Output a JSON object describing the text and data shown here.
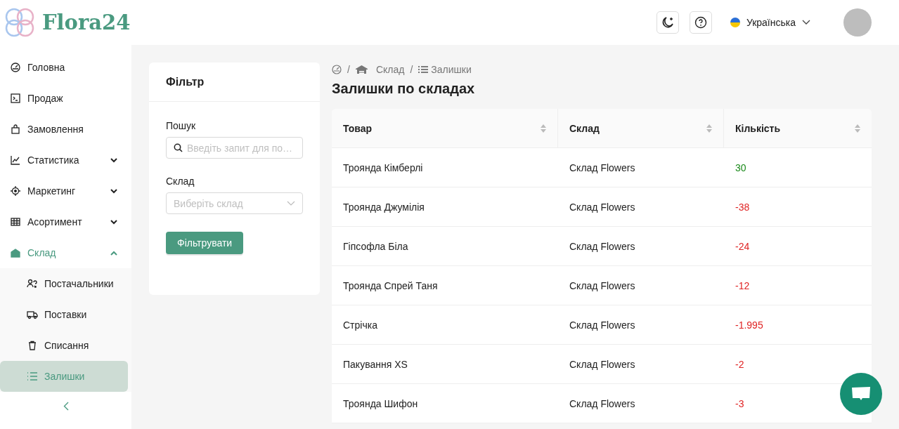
{
  "brand": "Flora24",
  "header": {
    "language": "Українська"
  },
  "sidebar": {
    "items": [
      {
        "label": "Головна",
        "kind": "link",
        "selected": false
      },
      {
        "label": "Продаж",
        "kind": "link",
        "selected": false
      },
      {
        "label": "Замовлення",
        "kind": "link",
        "selected": false
      },
      {
        "label": "Статистика",
        "kind": "group",
        "expanded": false,
        "selected": false
      },
      {
        "label": "Маркетинг",
        "kind": "group",
        "expanded": false,
        "selected": false
      },
      {
        "label": "Асортимент",
        "kind": "group",
        "expanded": false,
        "selected": false
      },
      {
        "label": "Склад",
        "kind": "group",
        "expanded": true,
        "selected": true,
        "children": [
          {
            "label": "Постачальники",
            "selected": false
          },
          {
            "label": "Поставки",
            "selected": false
          },
          {
            "label": "Списання",
            "selected": false
          },
          {
            "label": "Залишки",
            "selected": true
          }
        ]
      }
    ]
  },
  "filter": {
    "title": "Фільтр",
    "search_label": "Пошук",
    "search": {
      "placeholder": "Введіть запит для по…"
    },
    "warehouse_label": "Склад",
    "warehouse": {
      "placeholder": "Виберіть склад"
    },
    "button": "Фільтрувати"
  },
  "breadcrumbs": [
    "Склад",
    "Залишки"
  ],
  "breadcrumb_separator": "/",
  "title": "Залишки по складах",
  "table": {
    "columns": [
      "Товар",
      "Склад",
      "Кількість"
    ],
    "rows": [
      {
        "product": "Троянда Кімберлі",
        "warehouse": "Склад Flowers",
        "quantity": "30",
        "color": "#1a8a1a"
      },
      {
        "product": "Троянда Джумілія",
        "warehouse": "Склад Flowers",
        "quantity": "-38",
        "color": "#e02424"
      },
      {
        "product": "Гіпсофла Біла",
        "warehouse": "Склад Flowers",
        "quantity": "-24",
        "color": "#e02424"
      },
      {
        "product": "Троянда Спрей Таня",
        "warehouse": "Склад Flowers",
        "quantity": "-12",
        "color": "#e02424"
      },
      {
        "product": "Стрічка",
        "warehouse": "Склад Flowers",
        "quantity": "-1.995",
        "color": "#e02424"
      },
      {
        "product": "Пакування XS",
        "warehouse": "Склад Flowers",
        "quantity": "-2",
        "color": "#e02424"
      },
      {
        "product": "Троянда Шифон",
        "warehouse": "Склад Flowers",
        "quantity": "-3",
        "color": "#e02424"
      }
    ]
  }
}
